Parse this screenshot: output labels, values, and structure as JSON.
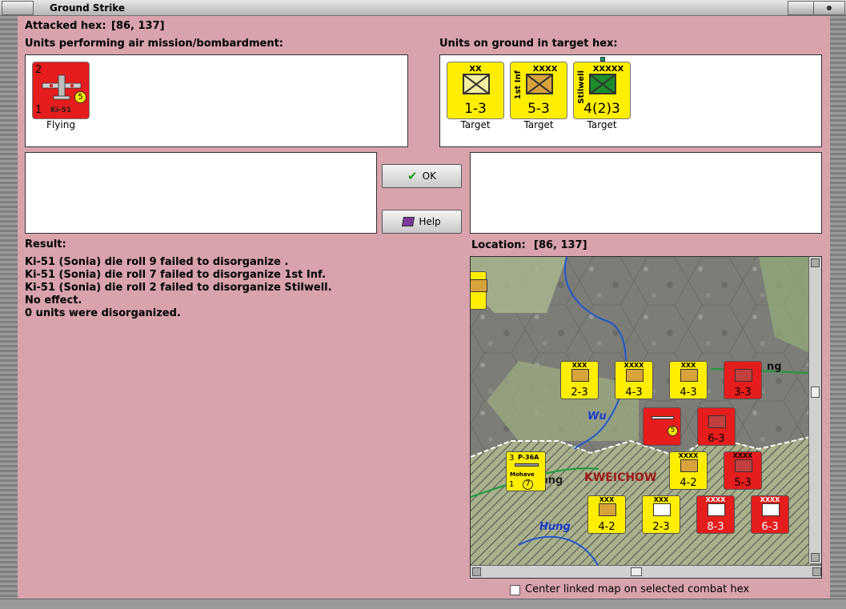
{
  "window": {
    "title": "Ground Strike"
  },
  "header": {
    "attacked_hex_label": "Attacked hex:",
    "attacked_hex_value": "[86, 137]"
  },
  "air_units": {
    "label": "Units performing air mission/bombardment:",
    "items": [
      {
        "name": "Ki-51",
        "top_left": "2",
        "bottom_left": "1",
        "rating": "5",
        "status": "Flying"
      }
    ]
  },
  "ground_units": {
    "label": "Units on ground in target hex:",
    "items": [
      {
        "size": "XX",
        "vertical_name": "",
        "strength": "1-3",
        "status": "Target",
        "box_color": "#f2eea0"
      },
      {
        "size": "XXXX",
        "vertical_name": "1st Inf",
        "strength": "5-3",
        "status": "Target",
        "box_color": "#d9a33b"
      },
      {
        "size": "XXXXX",
        "vertical_name": "Stilwell",
        "strength": "4(2)3",
        "status": "Target",
        "box_color": "#1b8d2a"
      }
    ]
  },
  "buttons": {
    "ok_label": "OK",
    "help_label": "Help"
  },
  "result": {
    "label": "Result:",
    "lines": [
      "Ki-51 (Sonia) die roll 9 failed to disorganize .",
      "Ki-51 (Sonia) die roll 7 failed to disorganize 1st Inf.",
      "Ki-51 (Sonia) die roll 2 failed to disorganize Stilwell.",
      "No effect.",
      "0 units were disorganized."
    ]
  },
  "location": {
    "label": "Location:",
    "value": "[86, 137]"
  },
  "map": {
    "labels": {
      "river_wu": "Wu",
      "river_hung": "Hung",
      "province": "KWEICHOW",
      "town_a": "ang",
      "town_b": "ng"
    },
    "counters": [
      {
        "strength": "2-3",
        "side": "yellow",
        "size": "XXX"
      },
      {
        "strength": "4-3",
        "side": "yellow",
        "size": "XXXX"
      },
      {
        "strength": "4-3",
        "side": "yellow",
        "size": "XXX"
      },
      {
        "strength": "3-3",
        "side": "red",
        "size": ""
      },
      {
        "strength": "6-3",
        "side": "red",
        "size": ""
      },
      {
        "strength": "4-2",
        "side": "yellow",
        "size": "XXXX"
      },
      {
        "strength": "5-3",
        "side": "red",
        "size": "XXXX"
      },
      {
        "strength": "4-2",
        "side": "yellow",
        "size": "XXX"
      },
      {
        "strength": "2-3",
        "side": "yellow",
        "size": "XXX"
      },
      {
        "strength": "8-3",
        "side": "red",
        "size": "XXXX"
      },
      {
        "strength": "6-3",
        "side": "red",
        "size": "XXXX"
      }
    ],
    "air_counter": {
      "name": "P-36A",
      "pilot": "Mohave",
      "top_left": "3",
      "bottom_left": "1",
      "rating": "7"
    },
    "enemy_air": {
      "name": "Ki-51",
      "rating": "5"
    }
  },
  "footer": {
    "center_map_label": "Center linked map on selected combat hex"
  },
  "colors": {
    "background": "#d8a3ad",
    "allied": "#ffee00",
    "japanese": "#e51d1d"
  }
}
